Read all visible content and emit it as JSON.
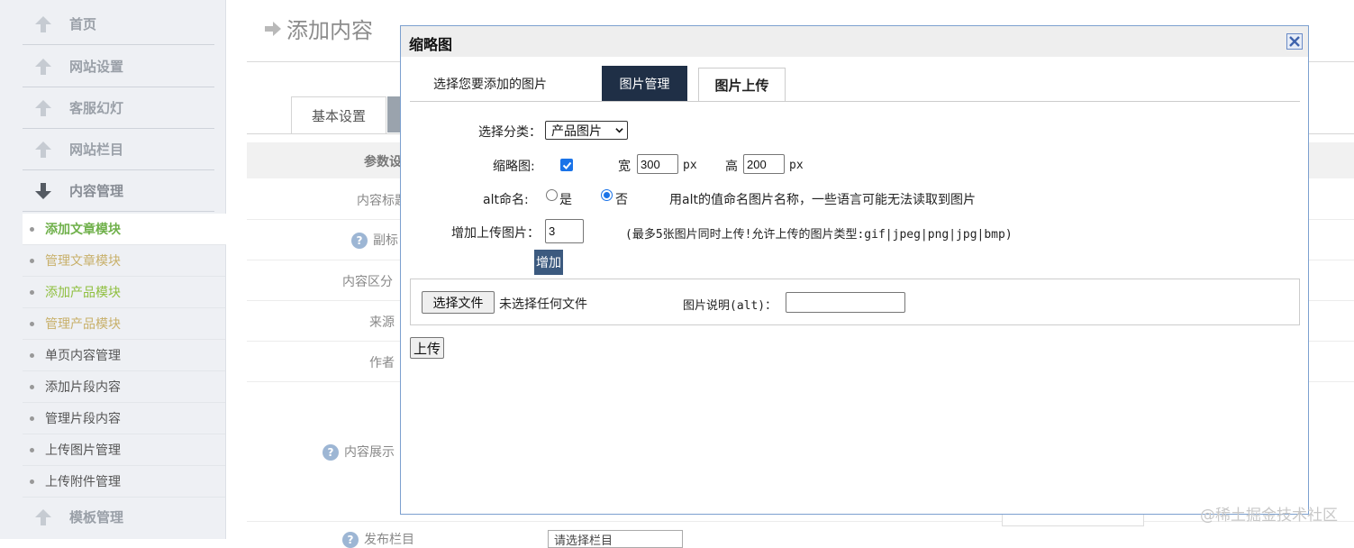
{
  "sidebar": {
    "sections": [
      "首页",
      "网站设置",
      "客服幻灯",
      "网站栏目",
      "内容管理"
    ],
    "items": [
      "添加文章模块",
      "管理文章模块",
      "添加产品模块",
      "管理产品模块",
      "单页内容管理",
      "添加片段内容",
      "管理片段内容",
      "上传图片管理",
      "上传附件管理"
    ],
    "bottom_section": "模板管理"
  },
  "main": {
    "title": "添加内容",
    "tab_basic": "基本设置",
    "header_label": "参数设",
    "rows": [
      "内容标题",
      "副标",
      "内容区分",
      "来源",
      "作者",
      "内容展示",
      "发布栏目"
    ],
    "bottom_select": "请选择栏目"
  },
  "modal": {
    "title": "缩略图",
    "tabs_caption": "选择您要添加的图片",
    "tab_mgmt": "图片管理",
    "tab_upload": "图片上传",
    "category_label": "选择分类：",
    "category_value": "产品图片",
    "thumb_label": "缩略图:",
    "thumb_checked": true,
    "width_label": "宽",
    "width_value": "300",
    "height_label": "高",
    "height_value": "200",
    "unit": "px",
    "alt_label": "alt命名:",
    "alt_yes": "是",
    "alt_no": "否",
    "alt_hint": "用alt的值命名图片名称，一些语言可能无法读取到图片",
    "count_label": "增加上传图片：",
    "count_value": "3",
    "count_hint": "(最多5张图片同时上传!允许上传的图片类型:gif|jpeg|png|jpg|bmp)",
    "add_button": "增加",
    "file_button": "选择文件",
    "no_file": "未选择任何文件",
    "alt_desc_label": "图片说明(alt)：",
    "upload_button": "上传"
  },
  "watermark": "@稀土掘金技术社区",
  "colors": {
    "tab_active": "#1f2f46",
    "accent": "#1a73e8",
    "sidebar_active": "#6fb04a"
  }
}
